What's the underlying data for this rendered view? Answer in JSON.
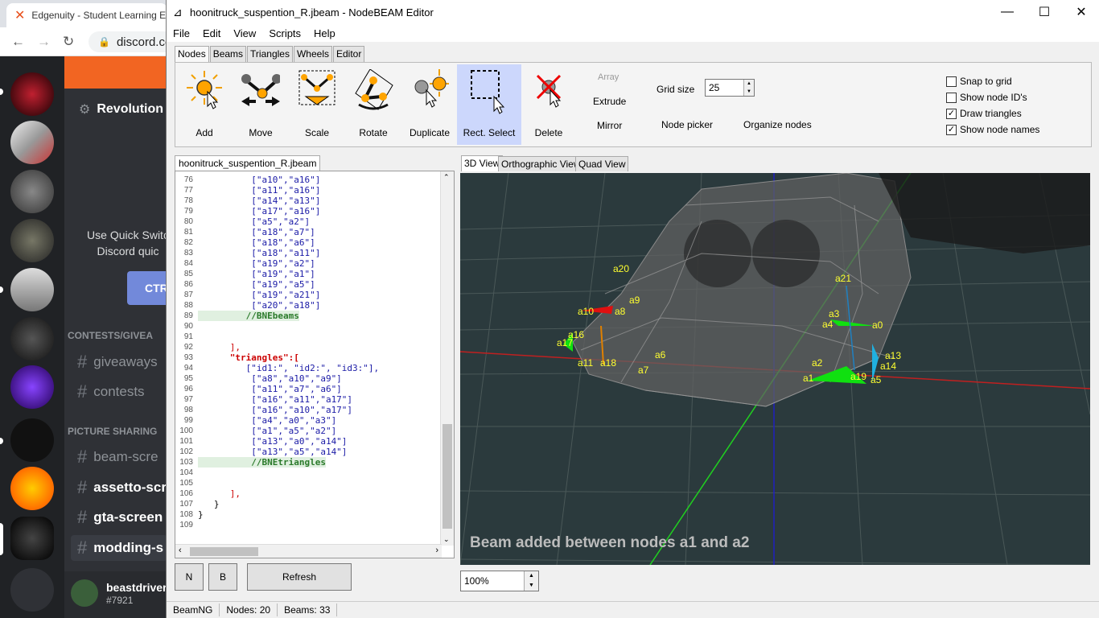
{
  "browser": {
    "tab_title": "Edgenuity - Student Learning E",
    "url": "discord.co"
  },
  "discord": {
    "server_name": "Revolution",
    "quick_switch_line1": "Use Quick Switc",
    "quick_switch_line2": "Discord quic",
    "quick_switch_button": "CTR",
    "categories": [
      "CONTESTS/GIVEA",
      "PICTURE SHARING"
    ],
    "channels": [
      "giveaways",
      "contests",
      "beam-scre",
      "assetto-scr",
      "gta-screen",
      "modding-s"
    ],
    "user": {
      "name": "beastdriver",
      "tag": "#7921"
    }
  },
  "nodebeam": {
    "window_title": "hoonitruck_suspention_R.jbeam - NodeBEAM Editor",
    "menu": [
      "File",
      "Edit",
      "View",
      "Scripts",
      "Help"
    ],
    "ribbon_tabs": [
      "Nodes",
      "Beams",
      "Triangles",
      "Wheels",
      "Editor"
    ],
    "tools": {
      "add": "Add",
      "move": "Move",
      "scale": "Scale",
      "rotate": "Rotate",
      "duplicate": "Duplicate",
      "rect_select": "Rect. Select",
      "delete": "Delete"
    },
    "small_tools": {
      "array": "Array",
      "extrude": "Extrude",
      "mirror": "Mirror",
      "node_picker": "Node picker",
      "organize_nodes": "Organize nodes"
    },
    "grid_size_label": "Grid size",
    "grid_size_value": "25",
    "checkboxes": [
      {
        "label": "Snap to grid",
        "mark": ""
      },
      {
        "label": "Show node ID's",
        "mark": ""
      },
      {
        "label": "Draw triangles",
        "mark": "✓"
      },
      {
        "label": "Show node names",
        "mark": "✓"
      }
    ],
    "editor_tab": "hoonitruck_suspention_R.jbeam",
    "code": [
      {
        "n": "76",
        "t": "          [\"a10\",\"a16\"]",
        "c": "str"
      },
      {
        "n": "77",
        "t": "          [\"a11\",\"a16\"]",
        "c": "str"
      },
      {
        "n": "78",
        "t": "          [\"a14\",\"a13\"]",
        "c": "str"
      },
      {
        "n": "79",
        "t": "          [\"a17\",\"a16\"]",
        "c": "str"
      },
      {
        "n": "80",
        "t": "          [\"a5\",\"a2\"]",
        "c": "str"
      },
      {
        "n": "81",
        "t": "          [\"a18\",\"a7\"]",
        "c": "str"
      },
      {
        "n": "82",
        "t": "          [\"a18\",\"a6\"]",
        "c": "str"
      },
      {
        "n": "83",
        "t": "          [\"a18\",\"a11\"]",
        "c": "str"
      },
      {
        "n": "84",
        "t": "          [\"a19\",\"a2\"]",
        "c": "str"
      },
      {
        "n": "85",
        "t": "          [\"a19\",\"a1\"]",
        "c": "str"
      },
      {
        "n": "86",
        "t": "          [\"a19\",\"a5\"]",
        "c": "str"
      },
      {
        "n": "87",
        "t": "          [\"a19\",\"a21\"]",
        "c": "str"
      },
      {
        "n": "88",
        "t": "          [\"a20\",\"a18\"]",
        "c": "str"
      },
      {
        "n": "89",
        "t": "         //BNEbeams",
        "c": "cmt"
      },
      {
        "n": "90",
        "t": "",
        "c": ""
      },
      {
        "n": "91",
        "t": "",
        "c": ""
      },
      {
        "n": "92",
        "t": "      ],",
        "c": "brk"
      },
      {
        "n": "93",
        "t": "      \"triangles\":[",
        "c": "kw"
      },
      {
        "n": "94",
        "t": "         [\"id1:\", \"id2:\", \"id3:\"],",
        "c": "str"
      },
      {
        "n": "95",
        "t": "          [\"a8\",\"a10\",\"a9\"]",
        "c": "str"
      },
      {
        "n": "96",
        "t": "          [\"a11\",\"a7\",\"a6\"]",
        "c": "str"
      },
      {
        "n": "97",
        "t": "          [\"a16\",\"a11\",\"a17\"]",
        "c": "str"
      },
      {
        "n": "98",
        "t": "          [\"a16\",\"a10\",\"a17\"]",
        "c": "str"
      },
      {
        "n": "99",
        "t": "          [\"a4\",\"a0\",\"a3\"]",
        "c": "str"
      },
      {
        "n": "100",
        "t": "          [\"a1\",\"a5\",\"a2\"]",
        "c": "str"
      },
      {
        "n": "101",
        "t": "          [\"a13\",\"a0\",\"a14\"]",
        "c": "str"
      },
      {
        "n": "102",
        "t": "          [\"a13\",\"a5\",\"a14\"]",
        "c": "str"
      },
      {
        "n": "103",
        "t": "          //BNEtriangles",
        "c": "cmt"
      },
      {
        "n": "104",
        "t": "",
        "c": ""
      },
      {
        "n": "105",
        "t": "",
        "c": ""
      },
      {
        "n": "106",
        "t": "      ],",
        "c": "brk"
      },
      {
        "n": "107",
        "t": "   }",
        "c": ""
      },
      {
        "n": "108",
        "t": "}",
        "c": ""
      },
      {
        "n": "109",
        "t": "",
        "c": ""
      }
    ],
    "buttons": {
      "n": "N",
      "b": "B",
      "refresh": "Refresh"
    },
    "view_tabs": [
      "3D View",
      "Orthographic View",
      "Quad View"
    ],
    "node_labels": [
      "a20",
      "a21",
      "a9",
      "a10",
      "a8",
      "a3",
      "a4",
      "a0",
      "a16",
      "a17",
      "a6",
      "a13",
      "a11",
      "a18",
      "a2",
      "a14",
      "a7",
      "a1",
      "a19",
      "a5"
    ],
    "status_message": "Beam added between nodes a1 and a2",
    "zoom": "100%",
    "statusbar": {
      "app": "BeamNG",
      "nodes": "Nodes: 20",
      "beams": "Beams: 33"
    }
  }
}
